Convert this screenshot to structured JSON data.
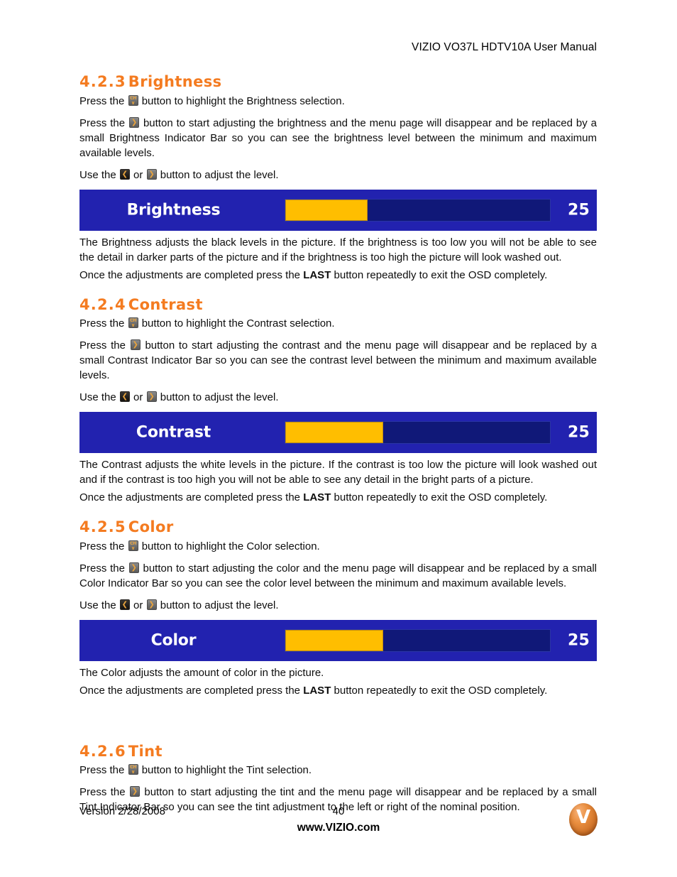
{
  "header": {
    "title": "VIZIO VO37L HDTV10A User Manual"
  },
  "sections": [
    {
      "id": "brightness",
      "heading_number": "4.2.3",
      "heading_title": "Brightness",
      "para1_a": "Press the",
      "para1_b": "button to highlight the Brightness selection.",
      "para2_a": "Press the",
      "para2_b": "button to start adjusting the brightness and the menu page will disappear and be replaced by a small Brightness Indicator Bar so you can see the brightness level between the minimum and maximum available levels.",
      "para3_a": "Use the",
      "para3_or": "or",
      "para3_b": "button to adjust the level.",
      "osd": {
        "label": "Brightness",
        "value": "25",
        "fill_percent": 31
      },
      "desc": "The Brightness adjusts the black levels in the picture.  If the brightness is too low you will not be able to see the detail in darker parts of the picture and if the brightness is too high the picture will look washed out.",
      "exit_a": "Once the adjustments are completed press the",
      "exit_kw": "LAST",
      "exit_b": "button repeatedly to exit the OSD completely."
    },
    {
      "id": "contrast",
      "heading_number": "4.2.4",
      "heading_title": "Contrast",
      "para1_a": "Press the",
      "para1_b": "button to highlight the Contrast selection.",
      "para2_a": "Press the",
      "para2_b": "button to start adjusting the contrast and the menu page will disappear and be replaced by a small Contrast Indicator Bar so you can see the contrast level between the minimum and maximum available levels.",
      "para3_a": "Use the",
      "para3_or": "or",
      "para3_b": "button to adjust the level.",
      "osd": {
        "label": "Contrast",
        "value": "25",
        "fill_percent": 37
      },
      "desc": "The Contrast adjusts the white levels in the picture.  If the contrast is too low the picture will look washed out and if the contrast is too high you will not be able to see any detail in the bright parts of a picture.",
      "exit_a": "Once the adjustments are completed press the",
      "exit_kw": "LAST",
      "exit_b": "button repeatedly to exit the OSD completely."
    },
    {
      "id": "color",
      "heading_number": "4.2.5",
      "heading_title": "Color",
      "para1_a": "Press the",
      "para1_b": "button to highlight the Color selection.",
      "para2_a": "Press the",
      "para2_b": "button to start adjusting the color and the menu page will disappear and be replaced by a small Color Indicator Bar so you can see the color level between the minimum and maximum available levels.",
      "para3_a": "Use the",
      "para3_or": "or",
      "para3_b": "button to adjust the level.",
      "osd": {
        "label": "Color",
        "value": "25",
        "fill_percent": 37
      },
      "desc": "The Color adjusts the amount of color in the picture.",
      "exit_a": "Once the adjustments are completed press the",
      "exit_kw": "LAST",
      "exit_b": "button repeatedly to exit the OSD completely."
    },
    {
      "id": "tint",
      "heading_number": "4.2.6",
      "heading_title": "Tint",
      "para1_a": "Press the",
      "para1_b": "button to highlight the Tint selection.",
      "para2_a": "Press the",
      "para2_b": "button to start adjusting the tint and the menu page will disappear and be replaced by a small Tint Indicator Bar so you can see the tint adjustment to the left or right of the nominal position."
    }
  ],
  "icons": {
    "ch_down_line1": "CH",
    "ch_down_line2": "∨",
    "arrow_right": "❮",
    "arrow_left": "❯"
  },
  "footer": {
    "version": "Version 2/28/2008",
    "page_number": "40",
    "website": "www.VIZIO.com",
    "logo_letter": "V"
  },
  "colors": {
    "heading_orange": "#F47B20",
    "osd_panel_blue": "#2222AF",
    "osd_track_blue": "#101878",
    "osd_fill_yellow": "#FFBE00",
    "logo_orange": "#E98E3F"
  }
}
